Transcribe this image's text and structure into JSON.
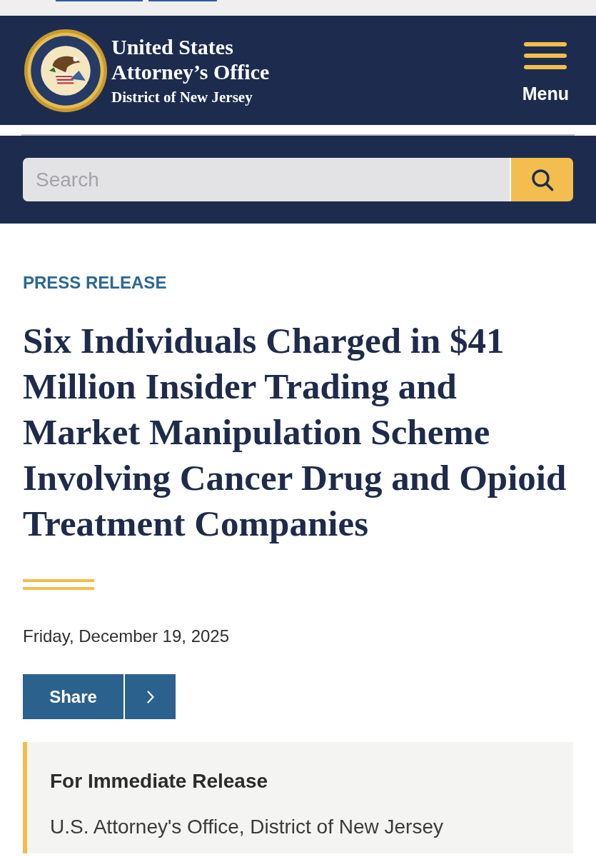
{
  "header": {
    "title": "United States Attorney’s Office",
    "subtitle": "District of New Jersey",
    "menu_label": "Menu"
  },
  "search": {
    "placeholder": "Search"
  },
  "article": {
    "category": "PRESS RELEASE",
    "headline": "Six Individuals Charged in $41 Million Insider Trading and Market Manipulation Scheme Involving Cancer Drug and Opioid Treatment Companies",
    "date": "Friday, December 19, 2025",
    "share_label": "Share"
  },
  "release_info": {
    "heading": "For Immediate Release",
    "office": "U.S. Attorney's Office, District of New Jersey"
  }
}
